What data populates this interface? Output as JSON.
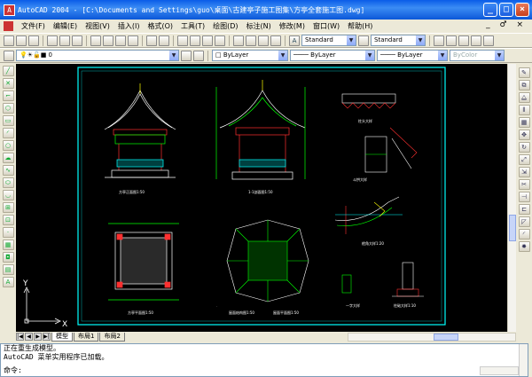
{
  "window": {
    "title": "AutoCAD 2004 - [C:\\Documents and Settings\\guo\\桌面\\古建亭子施工图集\\方亭全套施工图.dwg]",
    "app_icon": "autocad-icon",
    "controls": [
      "_",
      "□",
      "×"
    ]
  },
  "menu": {
    "items": [
      "文件(F)",
      "编辑(E)",
      "视图(V)",
      "插入(I)",
      "格式(O)",
      "工具(T)",
      "绘图(D)",
      "标注(N)",
      "修改(M)",
      "窗口(W)",
      "帮助(H)"
    ],
    "mdi_controls": "_ ♂ ×"
  },
  "toolbar1": {
    "text_style": "Standard",
    "dim_style": "Standard"
  },
  "toolbar2": {
    "layer": "0",
    "color": "ByLayer",
    "linetype": "ByLayer",
    "lineweight": "ByLayer",
    "plotstyle": "ByColor"
  },
  "drawing": {
    "labels": {
      "front_elevation": "方亭正面图1:50",
      "section": "1-1剖面图1:50",
      "plan": "方亭平面图1:50",
      "roof_framing": "屋面结构图1:50",
      "roof_plan": "屋面平面图1:50",
      "eave_detail": "檐角大样1:20",
      "column_detail": "柱头大样",
      "bracket_detail": "斗拱大样",
      "base_detail": "柱础大样1:10",
      "misc_detail": "一字大样"
    },
    "ucs": {
      "x": "X",
      "y": "Y"
    },
    "colors": {
      "background": "#000000",
      "frame": "#00ffff",
      "line_white": "#ffffff",
      "line_green": "#00ff00",
      "line_red": "#ff3030",
      "line_yellow": "#ffff00"
    }
  },
  "tabs": [
    "模型",
    "布局1",
    "布局2"
  ],
  "command": {
    "lines": [
      "正在重生成模型。",
      "AutoCAD 菜单实用程序已加载。"
    ],
    "prompt": "命令:"
  }
}
